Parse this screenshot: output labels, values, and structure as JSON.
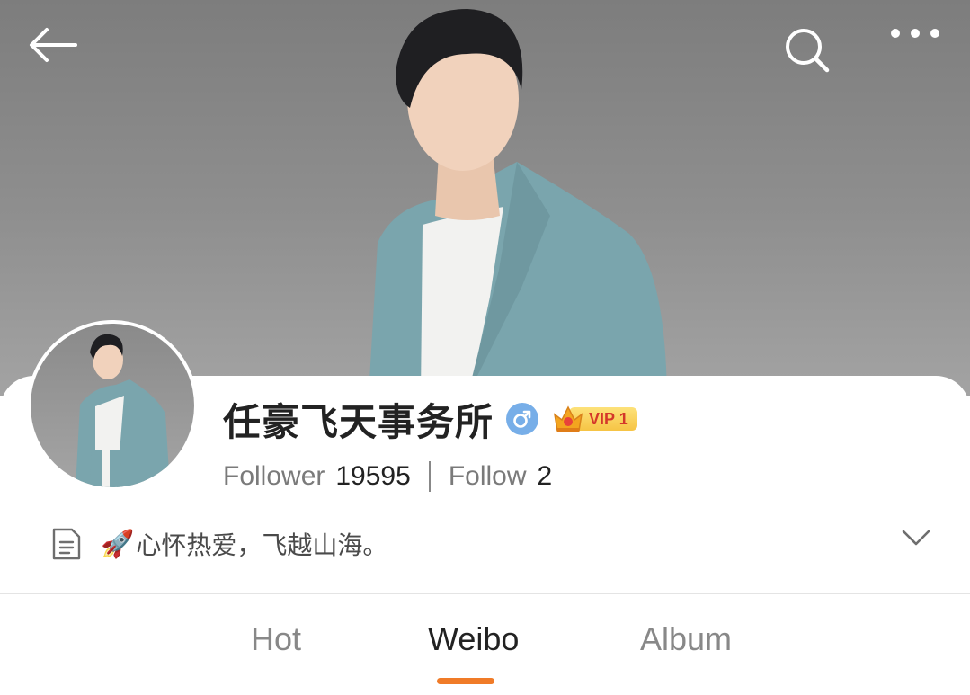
{
  "header": {
    "back_icon": "back-arrow-icon",
    "search_icon": "search-icon",
    "more_icon": "more-dots-icon"
  },
  "profile": {
    "name": "任豪飞天事务所",
    "gender_symbol": "♂",
    "vip_label": "VIP 1",
    "followers_label": "Follower",
    "followers_count": "19595",
    "following_label": "Follow",
    "following_count": "2",
    "bio": "心怀热爱，飞越山海。",
    "bio_emoji": "🚀"
  },
  "tabs": [
    {
      "label": "Hot"
    },
    {
      "label": "Weibo"
    },
    {
      "label": "Album"
    }
  ],
  "colors": {
    "accent": "#f07b28",
    "gender_badge": "#77aee8",
    "vip_gold": "#f6c445"
  }
}
